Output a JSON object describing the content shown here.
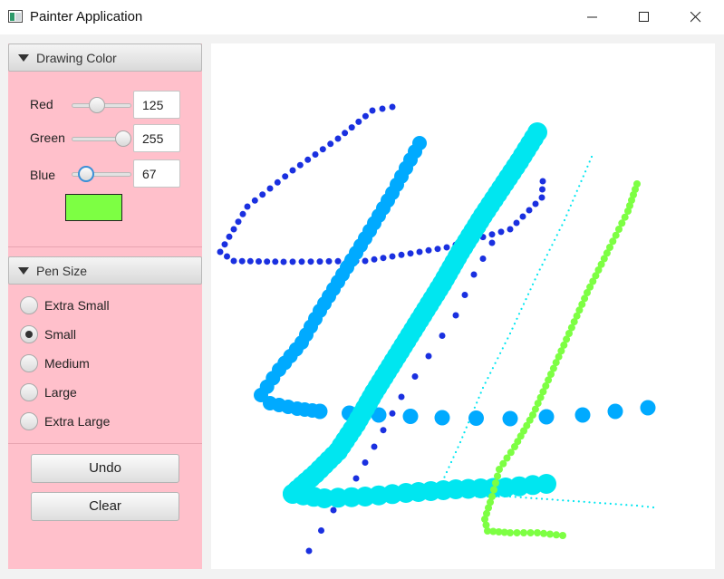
{
  "window": {
    "title": "Painter Application"
  },
  "color_pane": {
    "header": "Drawing Color",
    "sliders": [
      {
        "label": "Red",
        "value": "125",
        "fraction": 0.49
      },
      {
        "label": "Green",
        "value": "255",
        "fraction": 1.0
      },
      {
        "label": "Blue",
        "value": "67",
        "fraction": 0.26
      }
    ],
    "swatch_color": "#7dff43"
  },
  "pen_pane": {
    "header": "Pen Size",
    "options": [
      {
        "label": "Extra Small",
        "selected": false
      },
      {
        "label": "Small",
        "selected": true
      },
      {
        "label": "Medium",
        "selected": false
      },
      {
        "label": "Large",
        "selected": false
      },
      {
        "label": "Extra Large",
        "selected": false
      }
    ]
  },
  "actions": {
    "undo": "Undo",
    "clear": "Clear"
  },
  "colors": {
    "panel_background": "#ffc0cb",
    "stroke_blue": "#1a30e0",
    "stroke_azure": "#00aaff",
    "stroke_cyan": "#00e6f0",
    "stroke_green": "#7dff43"
  }
}
